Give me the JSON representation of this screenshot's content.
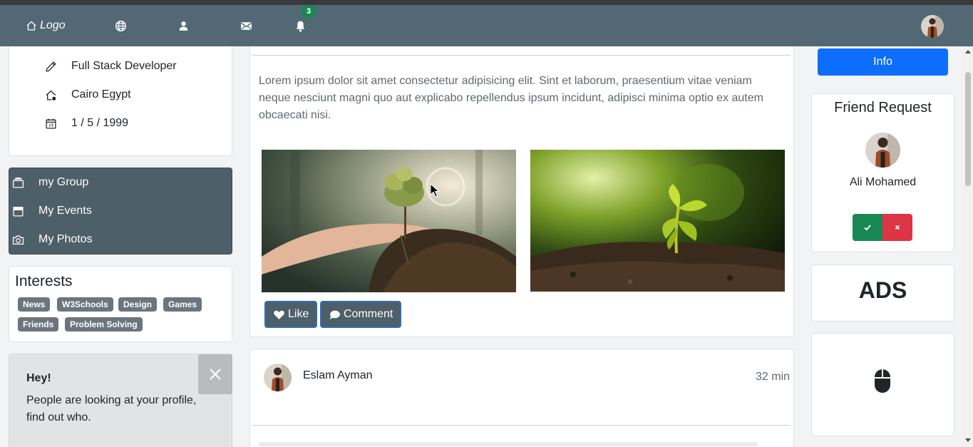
{
  "navbar": {
    "logo_label": "Logo",
    "notifications_count": "3",
    "icons": [
      "home-icon",
      "globe-icon",
      "user-icon",
      "envelope-icon",
      "bell-icon"
    ]
  },
  "profile": {
    "job": "Full Stack Developer",
    "location": "Cairo Egypt",
    "birthday": "1 / 5 / 1999"
  },
  "menu": {
    "items": [
      {
        "label": "my Group",
        "icon": "group-icon"
      },
      {
        "label": "My Events",
        "icon": "calendar-icon"
      },
      {
        "label": "My Photos",
        "icon": "camera-icon"
      }
    ]
  },
  "interests": {
    "title": "Interests",
    "tags": [
      "News",
      "W3Schools",
      "Design",
      "Games",
      "Friends",
      "Problem Solving"
    ]
  },
  "alert": {
    "title": "Hey!",
    "text": "People are looking at your profile, find out who."
  },
  "post": {
    "text": "Lorem ipsum dolor sit amet consectetur adipisicing elit. Sint et laborum, praesentium vitae veniam neque nesciunt magni quo aut explicabo repellendus ipsum incidunt, adipisci minima optio ex autem obcaecati nisi.",
    "like_label": "Like",
    "comment_label": "Comment"
  },
  "post2": {
    "author": "Eslam Ayman",
    "time": "32 min"
  },
  "sidebar_right": {
    "info_label": "Info",
    "friend_request_title": "Friend Request",
    "friend_name": "Ali Mohamed",
    "ads_label": "ADS"
  },
  "colors": {
    "navbar": "#536875",
    "menu": "#4d5f69",
    "primary": "#0d6efd",
    "success": "#198754",
    "danger": "#dc3545",
    "tag": "#6c757d"
  }
}
